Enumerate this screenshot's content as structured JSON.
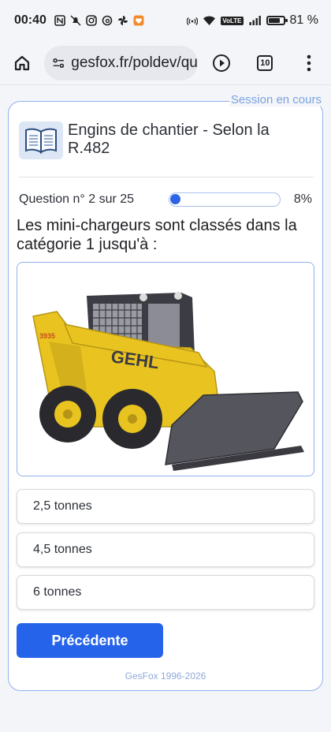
{
  "status_bar": {
    "time": "00:40",
    "battery_percent": "81 %",
    "battery_level": 0.81,
    "icons": [
      "nfc-icon",
      "mute-icon",
      "instagram-icon",
      "threads-icon",
      "pinwheel-icon",
      "app-heart-icon",
      "hotspot-icon",
      "wifi-icon",
      "volte-icon",
      "signal-icon",
      "battery-icon"
    ],
    "volte_label": "VoLTE"
  },
  "browser": {
    "url": "gesfox.fr/poldev/qu",
    "tab_count": "10",
    "icons": [
      "home-icon",
      "site-settings-icon",
      "play-icon",
      "tabs-icon",
      "more-icon"
    ]
  },
  "quiz": {
    "session_label": "Session en cours",
    "title": "Engins de chantier - Selon la R.482",
    "counter": "Question n° 2 sur 25",
    "progress_percent": "8%",
    "progress_value": 0.08,
    "question": "Les mini-chargeurs sont classés dans la catégorie 1 jusqu'à :",
    "answers": [
      {
        "label": "2,5 tonnes"
      },
      {
        "label": "4,5 tonnes"
      },
      {
        "label": "6 tonnes"
      }
    ],
    "previous_button": "Précédente",
    "footer": "GesFox 1996-2026"
  },
  "image": {
    "brand_text": "GEHL",
    "model_text": "3935",
    "accent_yellow": "#e9c420",
    "dark_grey": "#4a4a52"
  },
  "colors": {
    "primary": "#2563eb",
    "border_blue": "#8fb2ee",
    "session_text": "#7aa3e0"
  }
}
